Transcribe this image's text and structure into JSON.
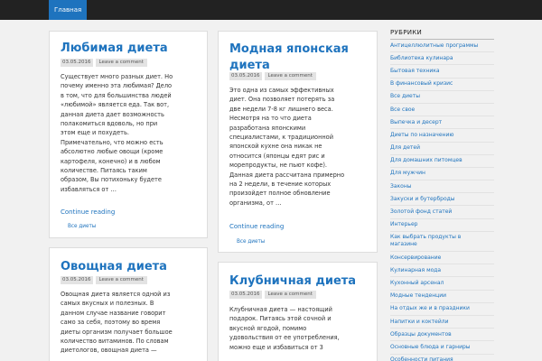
{
  "nav": {
    "home": "Главная"
  },
  "posts": [
    {
      "title": "Любимая диета",
      "date": "03.05.2016",
      "comment": "Leave a comment",
      "excerpt": "Существует много разных диет. Но\nпочему именно эта любимая? Дело\nв том, что для большинства людей\n«любимой» является еда. Так вот,\nданная диета дает возможность\nполакомиться вдоволь, но при\nэтом еще и похудеть.\nПримечательно, что можно есть\nабсолютно любые овощи (кроме\nкартофеля, конечно) и в любом\nколичестве. Питаясь таким\nобразом, Вы потихоньку будете\nизбавляться от …",
      "more": "Continue reading",
      "category": "Все диеты"
    },
    {
      "title": "Модная японская\nдиета",
      "date": "03.05.2016",
      "comment": "Leave a comment",
      "excerpt": "Это одна из самых эффективных\nдиет. Она позволяет потерять  за\nдве недели 7-8 кг лишнего веса.\nНесмотря на то что диета\nразработана японскими\nспециалистами, к традиционной\nяпонской кухне она никак не\nотносится  (японцы едят рис и\nморепродукты, не пьют кофе).\nДанная диета рассчитана примерно\nна 2 недели, в течение которых\nпроизойдет полное обновление\nорганизма, от …",
      "more": "Continue reading",
      "category": "Все диеты"
    },
    {
      "title": "Овощная диета",
      "date": "03.05.2016",
      "comment": "Leave a comment",
      "excerpt": "Овощная диета является одной из\nсамых вкусных и полезных. В\nданном случае название говорит\nсамо за себя, поэтому во время\nдиеты организм получает большое\nколичество витаминов. По словам\nдиетологов, овощная диета —",
      "more": "",
      "category": ""
    },
    {
      "title": "Клубничная диета",
      "date": "03.05.2016",
      "comment": "Leave a comment",
      "excerpt": "Клубничная диета — настоящий\nподарок. Питаясь этой сочной и\nвкусной ягодой, помимо\nудовольствия от ее употребления,\nможно еще и избавиться от 3",
      "more": "",
      "category": ""
    }
  ],
  "sidebar": {
    "heading": "РУБРИКИ",
    "items": [
      "Антицеллюлитные программы",
      "Библиотека кулинара",
      "Бытовая техника",
      "В финансовый кризис",
      "Все диеты",
      "Все свое",
      "Выпечка и десерт",
      "Диеты по назначению",
      "Для детей",
      "Для домашних питомцев",
      "Для мужчин",
      "Законы",
      "Закуски и бутерброды",
      "Золотой фонд статей",
      "Интерьер",
      "Как выбрать продукты в\nмагазине",
      "Консервирование",
      "Кулинарная мода",
      "Кухонный арсенал",
      "Модные тенденции",
      "На отдых же и в праздники",
      "Напитки и коктейли",
      "Образцы документов",
      "Основные блюда и гарниры",
      "Особенности питания"
    ]
  }
}
